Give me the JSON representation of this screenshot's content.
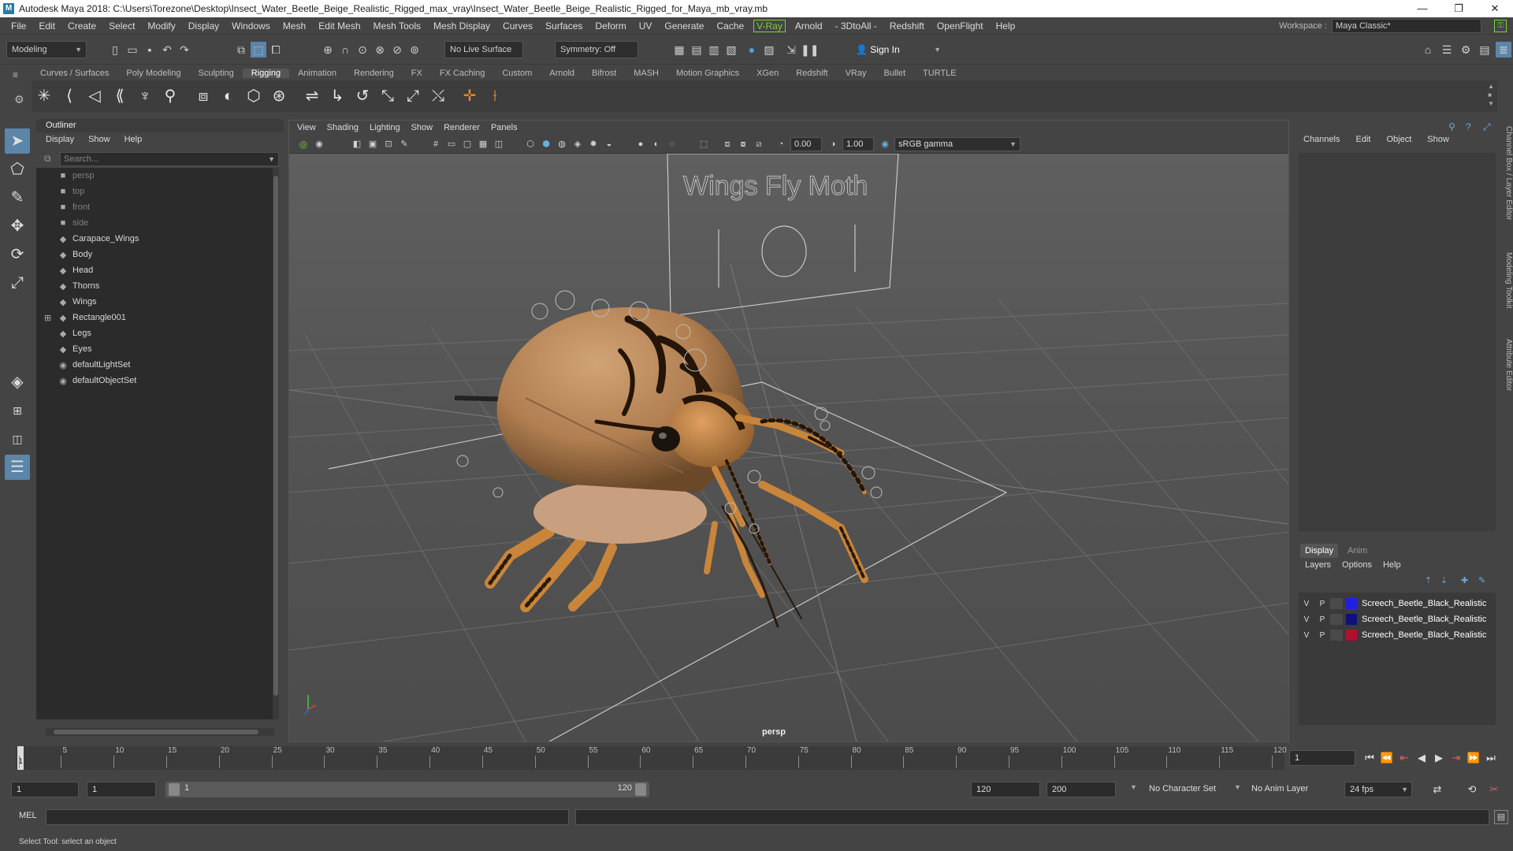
{
  "window": {
    "title": "Autodesk Maya 2018: C:\\Users\\Torezone\\Desktop\\Insect_Water_Beetle_Beige_Realistic_Rigged_max_vray\\Insect_Water_Beetle_Beige_Realistic_Rigged_for_Maya_mb_vray.mb",
    "minimize": "—",
    "restore": "❐",
    "close": "✕"
  },
  "menubar": {
    "items": [
      "File",
      "Edit",
      "Create",
      "Select",
      "Modify",
      "Display",
      "Windows",
      "Mesh",
      "Edit Mesh",
      "Mesh Tools",
      "Mesh Display",
      "Curves",
      "Surfaces",
      "Deform",
      "UV",
      "Generate",
      "Cache",
      "V-Ray",
      "Arnold",
      "- 3DtoAll -",
      "Redshift",
      "OpenFlight",
      "Help"
    ],
    "workspace_label": "Workspace :",
    "workspace_value": "Maya Classic*"
  },
  "statusline": {
    "mode": "Modeling",
    "live_surface": "No Live Surface",
    "symmetry": "Symmetry: Off",
    "sign_in": "Sign In"
  },
  "shelf": {
    "tabs": [
      "Curves / Surfaces",
      "Poly Modeling",
      "Sculpting",
      "Rigging",
      "Animation",
      "Rendering",
      "FX",
      "FX Caching",
      "Custom",
      "Arnold",
      "Bifrost",
      "MASH",
      "Motion Graphics",
      "XGen",
      "Redshift",
      "VRay",
      "Bullet",
      "TURTLE"
    ],
    "active_tab": "Rigging"
  },
  "outliner": {
    "title": "Outliner",
    "menu": [
      "Display",
      "Show",
      "Help"
    ],
    "search_placeholder": "Search...",
    "items": [
      {
        "label": "persp",
        "icon": "camera-icon",
        "dim": true
      },
      {
        "label": "top",
        "icon": "camera-icon",
        "dim": true
      },
      {
        "label": "front",
        "icon": "camera-icon",
        "dim": true
      },
      {
        "label": "side",
        "icon": "camera-icon",
        "dim": true
      },
      {
        "label": "Carapace_Wings",
        "icon": "mesh-icon",
        "dim": false
      },
      {
        "label": "Body",
        "icon": "mesh-icon",
        "dim": false
      },
      {
        "label": "Head",
        "icon": "mesh-icon",
        "dim": false
      },
      {
        "label": "Thorns",
        "icon": "mesh-icon",
        "dim": false
      },
      {
        "label": "Wings",
        "icon": "mesh-icon",
        "dim": false
      },
      {
        "label": "Rectangle001",
        "icon": "mesh-icon",
        "dim": false,
        "expandable": true
      },
      {
        "label": "Legs",
        "icon": "mesh-icon",
        "dim": false
      },
      {
        "label": "Eyes",
        "icon": "mesh-icon",
        "dim": false
      },
      {
        "label": "defaultLightSet",
        "icon": "set-icon",
        "dim": false
      },
      {
        "label": "defaultObjectSet",
        "icon": "set-icon",
        "dim": false
      }
    ]
  },
  "viewport": {
    "menu": [
      "View",
      "Shading",
      "Lighting",
      "Show",
      "Renderer",
      "Panels"
    ],
    "exposure": "0.00",
    "gamma": "1.00",
    "color_space": "sRGB gamma",
    "camera_label": "persp",
    "control_panel_text": "Wings  Fly  Moth"
  },
  "channelbox": {
    "menu": [
      "Channels",
      "Edit",
      "Object",
      "Show"
    ],
    "side_tabs": [
      "Channel Box / Layer Editor",
      "Modeling Toolkit",
      "Attribute Editor"
    ]
  },
  "layereditor": {
    "tabs": [
      "Display",
      "Anim"
    ],
    "active_tab": "Display",
    "menu": [
      "Layers",
      "Options",
      "Help"
    ],
    "layers": [
      {
        "v": "V",
        "p": "P",
        "name": "Screech_Beetle_Black_Realistic",
        "color": "#1f20e6"
      },
      {
        "v": "V",
        "p": "P",
        "name": "Screech_Beetle_Black_Realistic",
        "color": "#10107a"
      },
      {
        "v": "V",
        "p": "P",
        "name": "Screech_Beetle_Black_Realistic",
        "color": "#b0102e"
      }
    ]
  },
  "timeslider": {
    "ticks": [
      "1",
      "5",
      "10",
      "15",
      "20",
      "25",
      "30",
      "35",
      "40",
      "45",
      "50",
      "55",
      "60",
      "65",
      "70",
      "75",
      "80",
      "85",
      "90",
      "95",
      "100",
      "105",
      "110",
      "115",
      "120"
    ],
    "current_frame": "1",
    "frame_field": "1"
  },
  "rangeslider": {
    "start_field": "1",
    "playback_start": "1",
    "range_start": "1",
    "range_end": "120",
    "playback_end": "120",
    "end_field": "200",
    "character_set": "No Character Set",
    "anim_layer": "No Anim Layer",
    "fps": "24 fps"
  },
  "commandline": {
    "label": "MEL"
  },
  "helpline": {
    "text": "Select Tool: select an object"
  }
}
